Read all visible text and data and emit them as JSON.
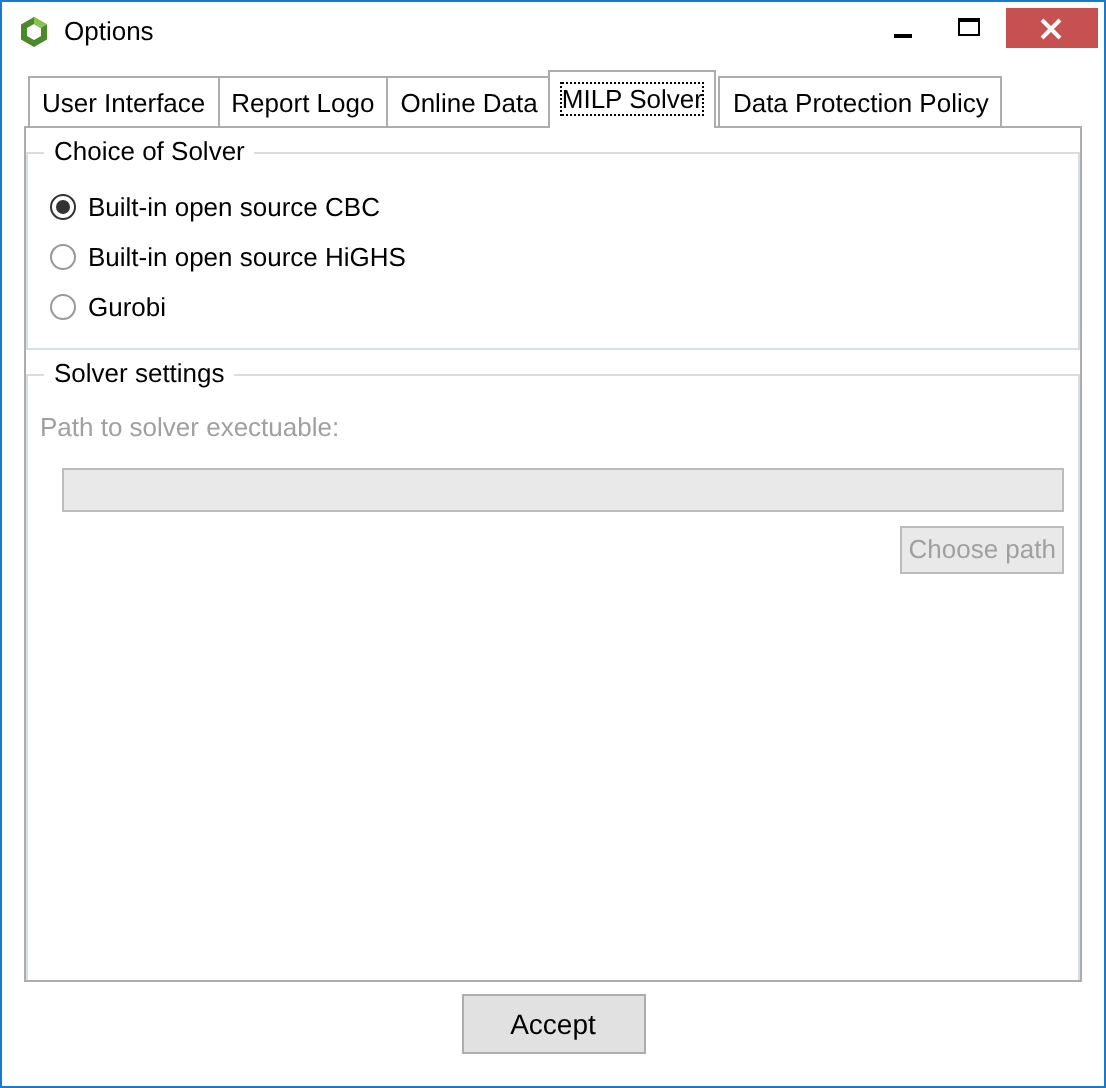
{
  "window": {
    "title": "Options"
  },
  "tabs": [
    {
      "label": "User Interface",
      "selected": false
    },
    {
      "label": "Report Logo",
      "selected": false
    },
    {
      "label": "Online Data",
      "selected": false
    },
    {
      "label": "MILP Solver",
      "selected": true
    },
    {
      "label": "Data Protection Policy",
      "selected": false
    }
  ],
  "solver_choice": {
    "title": "Choice of Solver",
    "options": [
      {
        "label": "Built-in open source CBC",
        "selected": true
      },
      {
        "label": "Built-in open source HiGHS",
        "selected": false
      },
      {
        "label": "Gurobi",
        "selected": false
      }
    ]
  },
  "solver_settings": {
    "title": "Solver settings",
    "path_label": "Path to solver exectuable:",
    "path_field": {
      "disabled": true
    },
    "choose_button": {
      "label": "Choose path",
      "disabled": true
    }
  },
  "buttons": [
    {
      "label": "Accept"
    }
  ]
}
